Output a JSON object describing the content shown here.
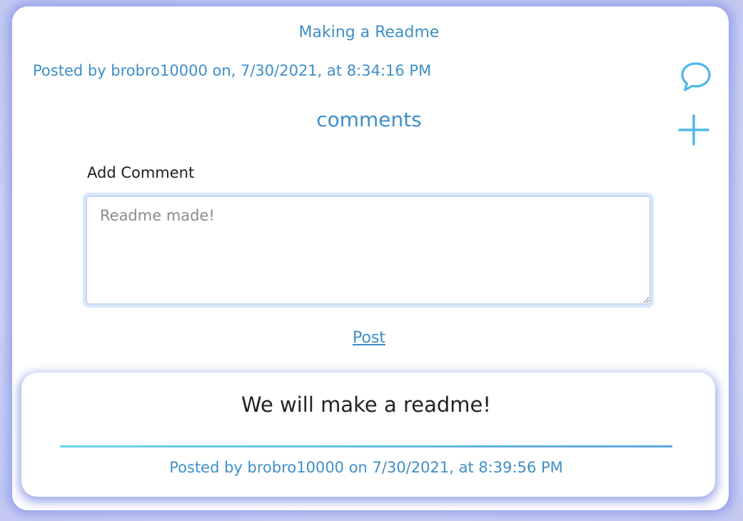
{
  "post": {
    "title": "Making a Readme",
    "meta": "Posted by brobro10000 on, 7/30/2021, at 8:34:16 PM"
  },
  "icons": {
    "comment": "speech-bubble-icon",
    "add": "plus-icon",
    "accent_color": "#4fb8e8"
  },
  "comments_section": {
    "heading": "comments",
    "add_label": "Add Comment",
    "textarea_value": "Readme made!",
    "post_button_label": "Post"
  },
  "comments": [
    {
      "text": "We will make a readme!",
      "meta": "Posted by brobro10000 on 7/30/2021, at 8:39:56 PM"
    }
  ],
  "colors": {
    "primary_text": "#3f8fc7",
    "background": "#c9d0f3",
    "divider_start": "#6ad5ee",
    "divider_end": "#5aa6e6"
  }
}
